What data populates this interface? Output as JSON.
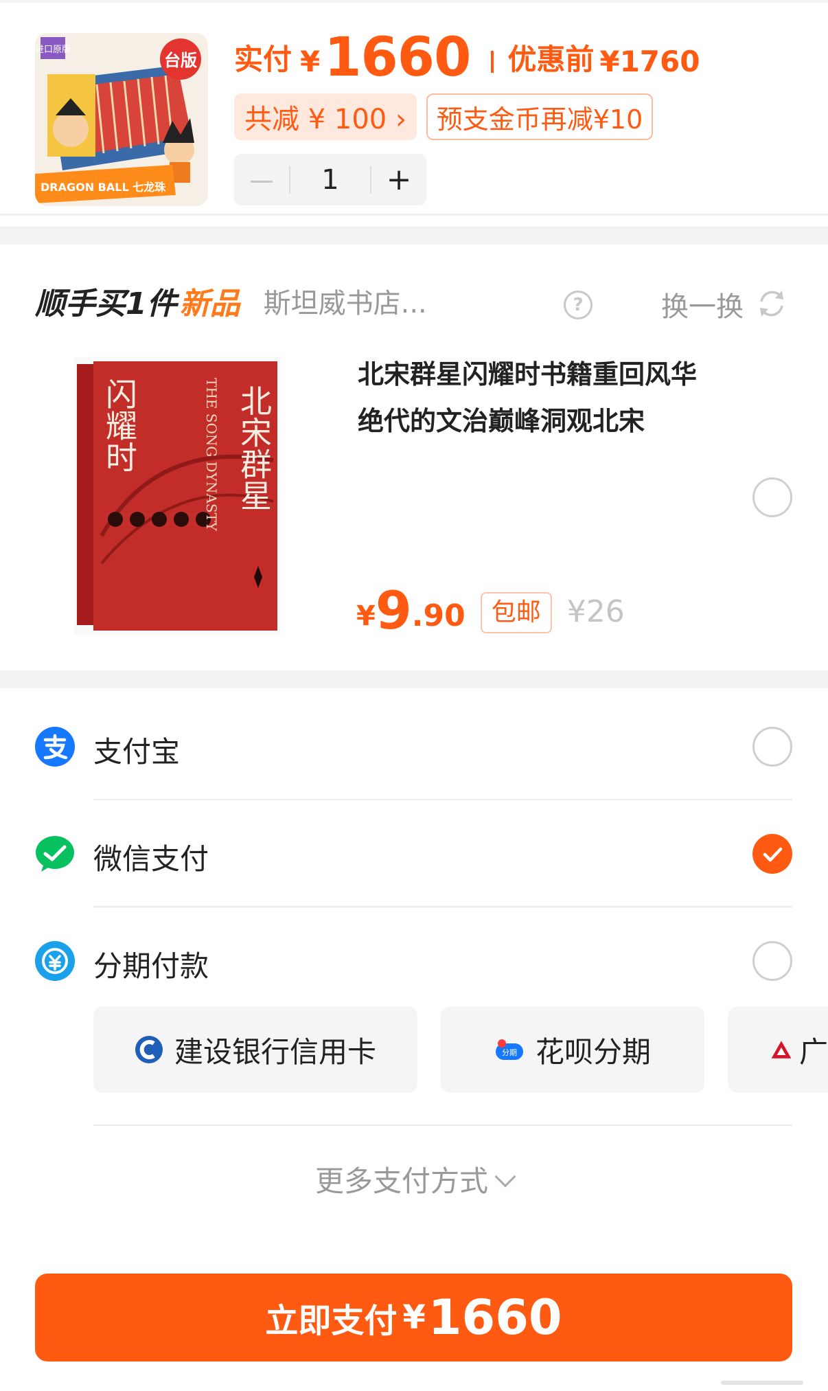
{
  "product": {
    "cover_caption": "DRAGON BALL 七龙珠",
    "cover_badge": "台版",
    "cover_corner": "进口原版",
    "paid_label": "实付",
    "currency": "¥",
    "paid_amount": "1660",
    "original_label": "优惠前",
    "original_value": "¥1760",
    "discount_chip": "共减 ¥ 100 ›",
    "coin_chip": "预支金币再减¥10",
    "stepper": {
      "minus": "－",
      "quantity": "1",
      "plus": "+"
    }
  },
  "addon": {
    "title": "顺手买1件",
    "title_highlight": "新品",
    "shop": "斯坦威书店...",
    "help_icon": "?",
    "swap_label": "换一换",
    "item": {
      "cover_title_main": "北宋群星",
      "cover_title_sub": "闪耀时",
      "cover_english": "THE SONG DYNASTY",
      "title": "北宋群星闪耀时书籍重回风华绝代的文治巅峰洞观北宋",
      "price_yen": "¥",
      "price_int": "9",
      "price_dec": ".90",
      "shipping": "包邮",
      "original_price": "¥26"
    }
  },
  "payment": {
    "methods": [
      {
        "label": "支付宝",
        "icon": "alipay-icon",
        "selected": false
      },
      {
        "label": "微信支付",
        "icon": "wechat-pay-icon",
        "selected": true
      },
      {
        "label": "分期付款",
        "icon": "installment-icon",
        "selected": false
      }
    ],
    "installments": [
      {
        "label": "建设银行信用卡",
        "icon": "ccb-icon"
      },
      {
        "label": "花呗分期",
        "icon": "huabei-icon",
        "icon_text": "分期"
      },
      {
        "label": "广",
        "icon": "gf-bank-icon"
      }
    ],
    "more_label": "更多支付方式"
  },
  "pay_button": {
    "label": "立即支付",
    "currency": "¥",
    "amount": "1660"
  },
  "colors": {
    "accent": "#ff5a12",
    "alipay": "#1677ff",
    "wechat": "#07c160",
    "installment": "#1aa1ea"
  }
}
